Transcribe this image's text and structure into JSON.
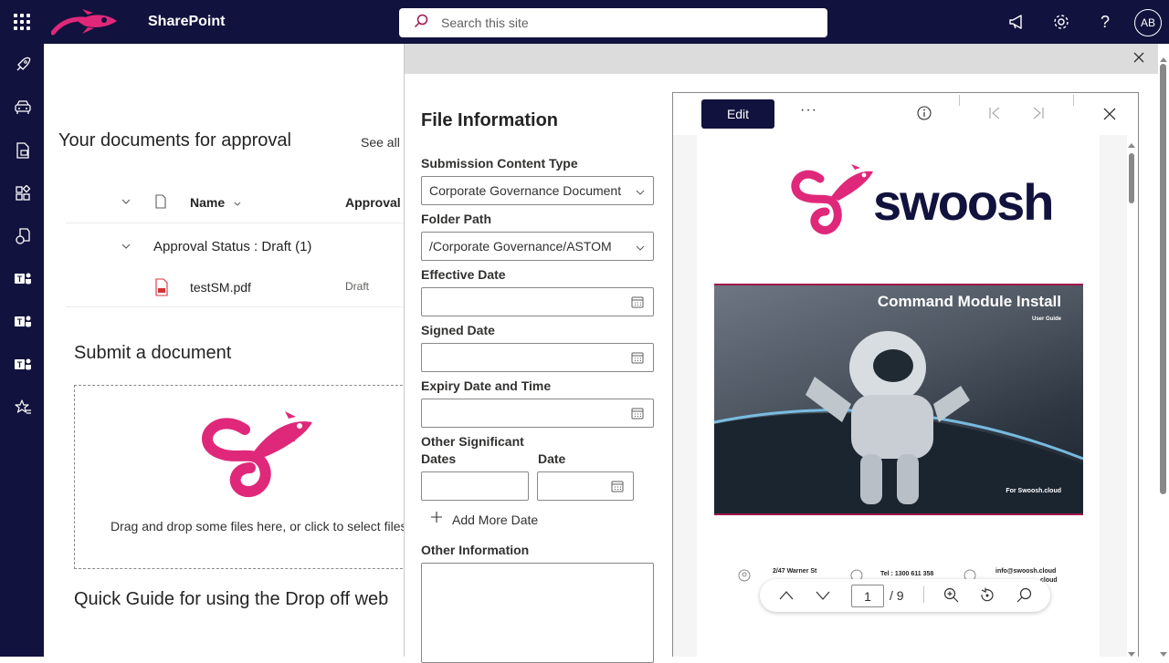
{
  "app": {
    "title": "SharePoint",
    "search_placeholder": "Search this site",
    "user_initials": "AB",
    "brand_color": "#12123e",
    "accent_color": "#e0287a"
  },
  "top_icons": [
    "megaphone-icon",
    "gear-icon",
    "help-icon"
  ],
  "rail_icons": [
    "rocket-icon",
    "car-icon",
    "document-upload-icon",
    "apps-icon",
    "documents-icon",
    "teams-icon",
    "teams-icon",
    "teams-icon",
    "star-list-icon"
  ],
  "approvals": {
    "title": "Your documents for approval",
    "see_all": "See all",
    "col_name": "Name",
    "col_approval": "Approval",
    "group_label": "Approval Status : Draft (1)",
    "rows": [
      {
        "file": "testSM.pdf",
        "status": "Draft"
      }
    ]
  },
  "submit": {
    "title": "Submit a document",
    "drop_text": "Drag and drop some files here, or click to select files"
  },
  "quick_guide": "Quick Guide for using the Drop off web",
  "form": {
    "title": "File Information",
    "content_type_label": "Submission Content Type",
    "content_type_value": "Corporate Governance Document",
    "folder_label": "Folder Path",
    "folder_value": "/Corporate Governance/ASTOM",
    "effective_label": "Effective Date",
    "signed_label": "Signed Date",
    "expiry_label": "Expiry Date and Time",
    "other_dates_label": "Other Significant Dates",
    "other_dates_line1": "Other Significant",
    "other_dates_line2": "Dates",
    "date_label": "Date",
    "add_more": "Add More Date",
    "other_info_label": "Other Information"
  },
  "viewer": {
    "edit": "Edit",
    "more": "···",
    "page_current": "1",
    "page_total": "/ 9",
    "doc_brand": "swoosh",
    "cover_title": "Command Module Install",
    "cover_subtitle": "User Guide",
    "cover_footer": "For Swoosh.cloud",
    "address": "2/47 Warner St",
    "phone": "Tel : 1300 611 358",
    "email": "info@swoosh.cloud",
    "web": "cloud"
  }
}
